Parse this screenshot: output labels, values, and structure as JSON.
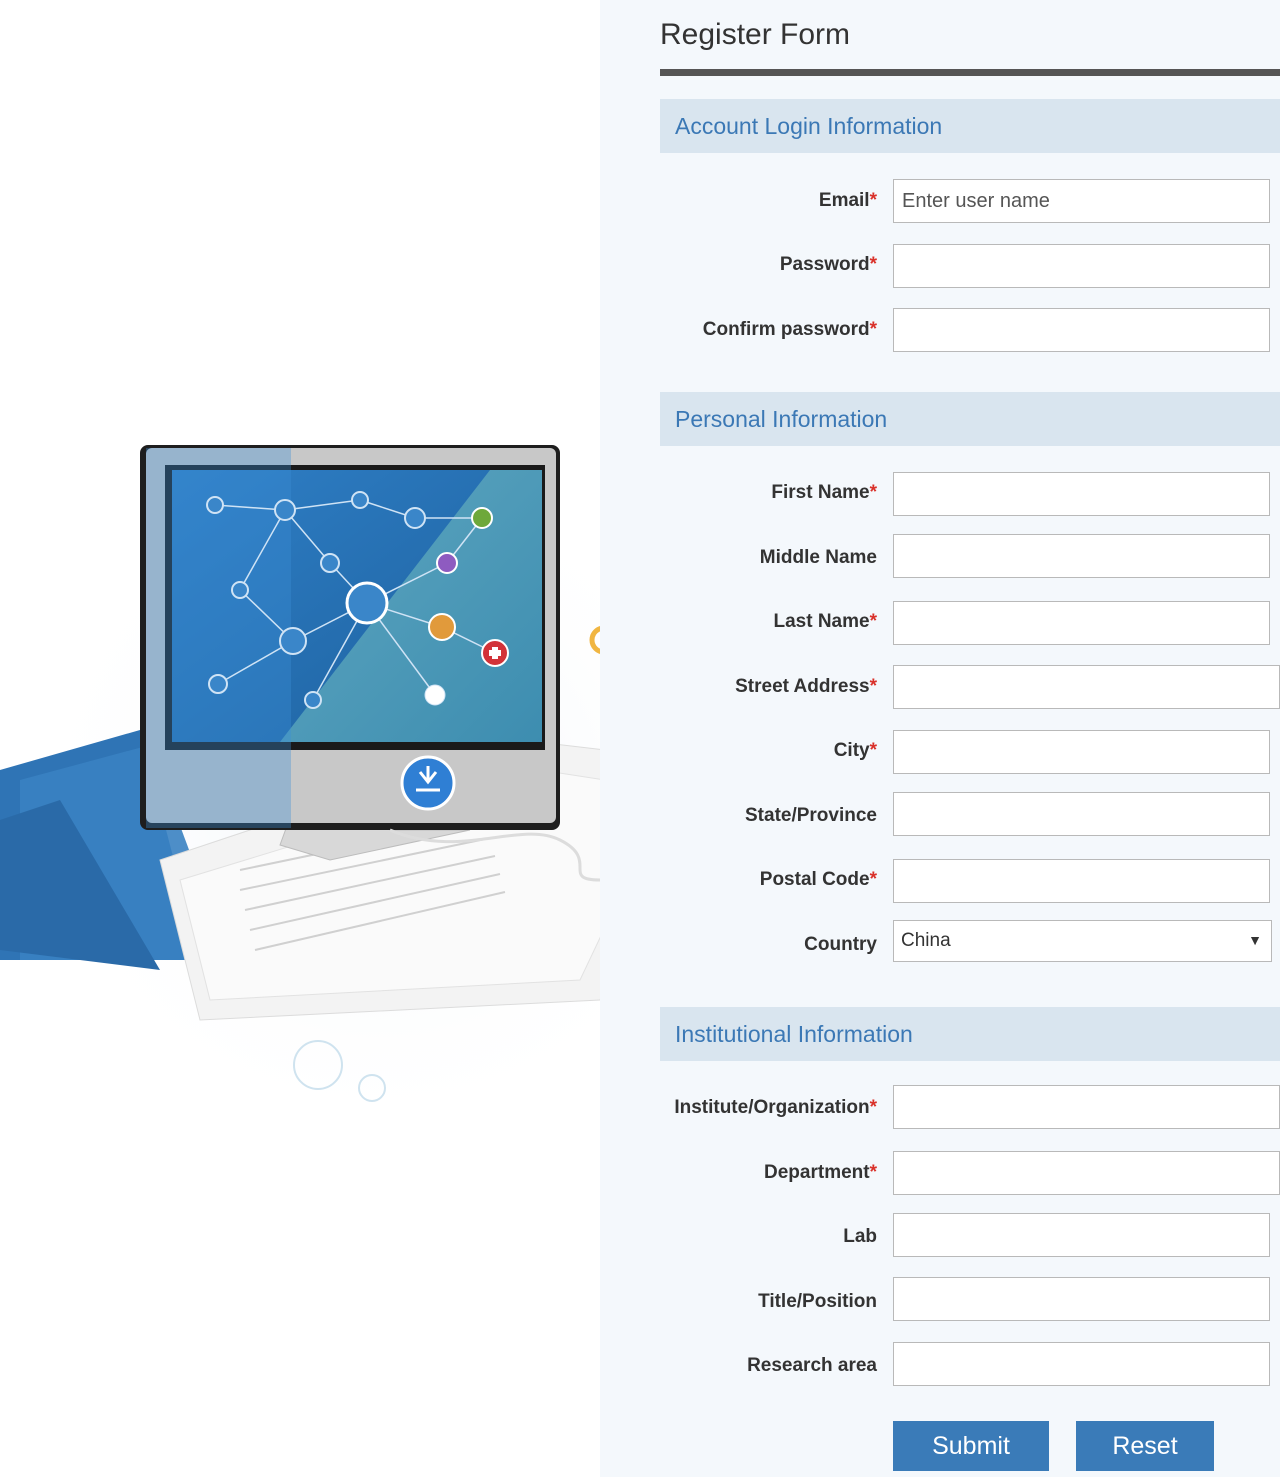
{
  "form": {
    "title": "Register Form",
    "submit_label": "Submit",
    "reset_label": "Reset"
  },
  "sections": {
    "account": {
      "title": "Account Login Information",
      "fields": {
        "email": {
          "label": "Email",
          "required": true,
          "placeholder": "Enter user name",
          "value": ""
        },
        "password": {
          "label": "Password",
          "required": true,
          "value": ""
        },
        "confirm_password": {
          "label": "Confirm password",
          "required": true,
          "value": ""
        }
      }
    },
    "personal": {
      "title": "Personal Information",
      "fields": {
        "first_name": {
          "label": "First Name",
          "required": true,
          "value": ""
        },
        "middle_name": {
          "label": "Middle Name",
          "required": false,
          "value": ""
        },
        "last_name": {
          "label": "Last Name",
          "required": true,
          "value": ""
        },
        "street_address": {
          "label": "Street Address",
          "required": true,
          "value": ""
        },
        "city": {
          "label": "City",
          "required": true,
          "value": ""
        },
        "state_province": {
          "label": "State/Province",
          "required": false,
          "value": ""
        },
        "postal_code": {
          "label": "Postal Code",
          "required": true,
          "value": ""
        },
        "country": {
          "label": "Country",
          "required": false,
          "selected": "China"
        }
      }
    },
    "institutional": {
      "title": "Institutional Information",
      "fields": {
        "institute": {
          "label": "Institute/Organization",
          "required": true,
          "value": ""
        },
        "department": {
          "label": "Department",
          "required": true,
          "value": ""
        },
        "lab": {
          "label": "Lab",
          "required": false,
          "value": ""
        },
        "title_position": {
          "label": "Title/Position",
          "required": false,
          "value": ""
        },
        "research_area": {
          "label": "Research area",
          "required": false,
          "value": ""
        }
      }
    }
  },
  "required_marker": "*",
  "illustration": {
    "icon": "computer-network-illustration"
  },
  "colors": {
    "accent": "#3a7bb8",
    "section_bg": "#d9e5ef",
    "section_text": "#3b78b5",
    "required": "#d9312a",
    "panel_bg": "#f4f8fc"
  }
}
